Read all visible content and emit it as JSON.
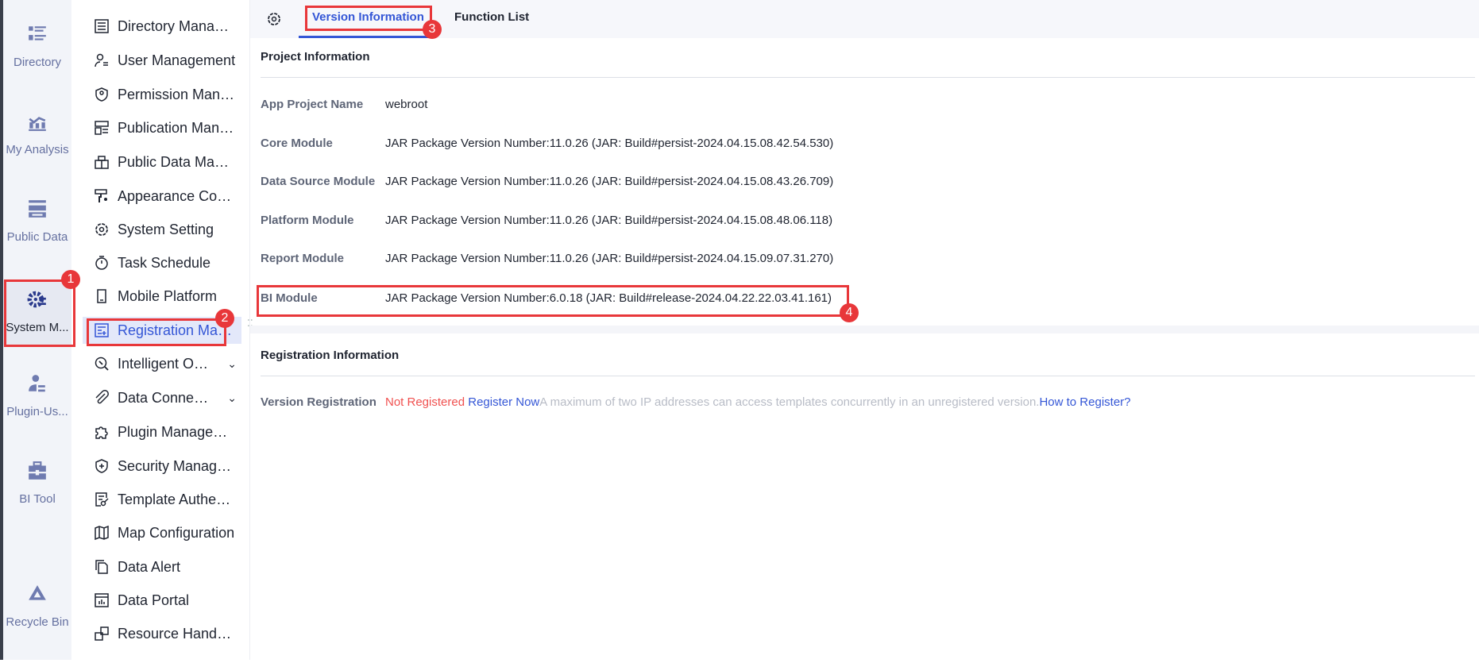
{
  "rail": [
    {
      "label": "Directory",
      "icon": "directory-icon"
    },
    {
      "label": "My Analysis",
      "icon": "analysis-icon"
    },
    {
      "label": "Public Data",
      "icon": "public-data-icon"
    },
    {
      "label": "System M...",
      "icon": "system-gear-icon"
    },
    {
      "label": "Plugin-Us...",
      "icon": "plugin-user-icon"
    },
    {
      "label": "BI Tool",
      "icon": "toolbox-icon"
    },
    {
      "label": "Recycle Bin",
      "icon": "recycle-bin-icon"
    }
  ],
  "menu": [
    {
      "label": "Directory Mana…"
    },
    {
      "label": "User Management"
    },
    {
      "label": "Permission Man…"
    },
    {
      "label": "Publication Man…"
    },
    {
      "label": "Public Data Ma…"
    },
    {
      "label": "Appearance Co…"
    },
    {
      "label": "System Setting"
    },
    {
      "label": "Task Schedule"
    },
    {
      "label": "Mobile Platform"
    },
    {
      "label": "Registration Ma…"
    },
    {
      "label": "Intelligent O…",
      "chevron": "⌄"
    },
    {
      "label": "Data Conne…",
      "chevron": "⌄"
    },
    {
      "label": "Plugin Manage…"
    },
    {
      "label": "Security Manag…"
    },
    {
      "label": "Template Authe…"
    },
    {
      "label": "Map Configuration"
    },
    {
      "label": "Data Alert"
    },
    {
      "label": "Data Portal"
    },
    {
      "label": "Resource Hand…"
    }
  ],
  "tabs": {
    "version": "Version Information",
    "functions": "Function List"
  },
  "project": {
    "title": "Project Information",
    "rows": [
      {
        "label": "App Project Name",
        "value": "webroot"
      },
      {
        "label": "Core Module",
        "value": "JAR Package Version Number:11.0.26  (JAR:  Build#persist-2024.04.15.08.42.54.530)"
      },
      {
        "label": "Data Source Module",
        "value": "JAR Package Version Number:11.0.26  (JAR:  Build#persist-2024.04.15.08.43.26.709)"
      },
      {
        "label": "Platform Module",
        "value": "JAR Package Version Number:11.0.26  (JAR:  Build#persist-2024.04.15.08.48.06.118)"
      },
      {
        "label": "Report Module",
        "value": "JAR Package Version Number:11.0.26  (JAR:  Build#persist-2024.04.15.09.07.31.270)"
      },
      {
        "label": "BI Module",
        "value": "JAR Package Version Number:6.0.18  (JAR:  Build#release-2024.04.22.22.03.41.161)"
      }
    ]
  },
  "registration": {
    "title": "Registration Information",
    "label": "Version Registration",
    "status": "Not Registered",
    "register_now": "Register Now",
    "note": "A maximum of two IP addresses can access templates concurrently in an unregistered version.",
    "how": "How to Register?"
  },
  "badges": [
    "1",
    "2",
    "3",
    "4"
  ],
  "colors": {
    "accent": "#3456d6",
    "danger": "#e8373a",
    "status": "#f0504f"
  }
}
